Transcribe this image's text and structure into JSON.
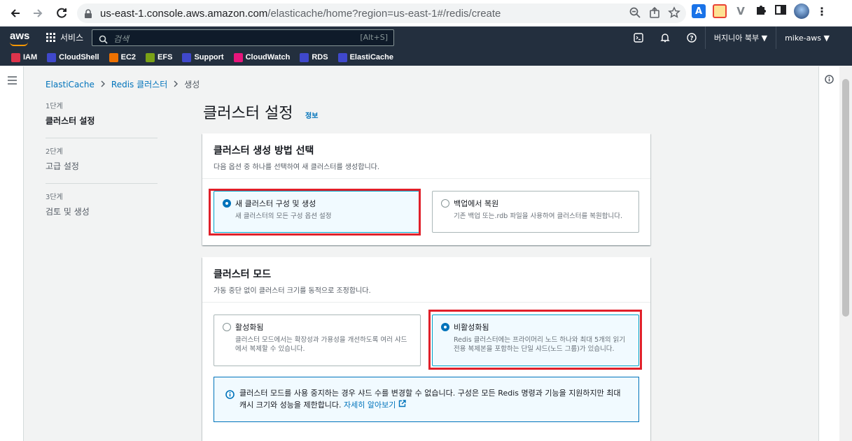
{
  "browser": {
    "url_host": "us-east-1.console.aws.amazon.com",
    "url_path": "/elasticache/home?region=us-east-1#/redis/create"
  },
  "header": {
    "logo": "aws",
    "services_label": "서비스",
    "search_placeholder": "검색",
    "search_shortcut": "[Alt+S]",
    "region_label": "버지니아 북부 ▼",
    "user_label": "mike-aws ▼"
  },
  "bookmarks": [
    {
      "label": "IAM",
      "color": "#dd344c",
      "glyph": "IAM"
    },
    {
      "label": "CloudShell",
      "color": "#3f48cc",
      "glyph": ">_"
    },
    {
      "label": "EC2",
      "color": "#ed7100",
      "glyph": "EC2"
    },
    {
      "label": "EFS",
      "color": "#7aa116",
      "glyph": "EFS"
    },
    {
      "label": "Support",
      "color": "#3f48cc",
      "glyph": "?"
    },
    {
      "label": "CloudWatch",
      "color": "#e7157b",
      "glyph": "CW"
    },
    {
      "label": "RDS",
      "color": "#3f48cc",
      "glyph": "DB"
    },
    {
      "label": "ElastiCache",
      "color": "#3f48cc",
      "glyph": "EC"
    }
  ],
  "breadcrumb": {
    "items": [
      "ElastiCache",
      "Redis 클러스터",
      "생성"
    ]
  },
  "steps": [
    {
      "num": "1단계",
      "name": "클러스터 설정"
    },
    {
      "num": "2단계",
      "name": "고급 설정"
    },
    {
      "num": "3단계",
      "name": "검토 및 생성"
    }
  ],
  "page": {
    "title": "클러스터 설정",
    "info": "정보"
  },
  "creation_method": {
    "title": "클러스터 생성 방법 선택",
    "desc": "다음 옵션 중 하나를 선택하여 새 클러스터를 생성합니다.",
    "options": [
      {
        "title": "새 클러스터 구성 및 생성",
        "desc": "새 클러스터의 모든 구성 옵션 설정",
        "selected": true
      },
      {
        "title": "백업에서 복원",
        "desc": "기존 백업 또는.rdb 파일을 사용하여 클러스터를 복원합니다.",
        "selected": false
      }
    ]
  },
  "cluster_mode": {
    "title": "클러스터 모드",
    "desc": "가동 중단 없이 클러스터 크기를 동적으로 조정합니다.",
    "options": [
      {
        "title": "활성화됨",
        "desc": "클러스터 모드에서는 확장성과 가용성을 개선하도록 여러 샤드에서 복제할 수 있습니다.",
        "selected": false
      },
      {
        "title": "비활성화됨",
        "desc": "Redis 클러스터에는 프라이머리 노드 하나와 최대 5개의 읽기 전용 복제본을 포함하는 단일 샤드(노드 그룹)가 있습니다.",
        "selected": true
      }
    ],
    "alert_text": "클러스터 모드를 사용 중지하는 경우 샤드 수를 변경할 수 없습니다. 구성은 모든 Redis 명령과 기능을 지원하지만 최대 캐시 크기와 성능을 제한합니다.",
    "alert_link": "자세히 알아보기"
  },
  "colors": {
    "aws_nav": "#232f3e",
    "link": "#0073bb",
    "highlight": "#e0202a"
  }
}
